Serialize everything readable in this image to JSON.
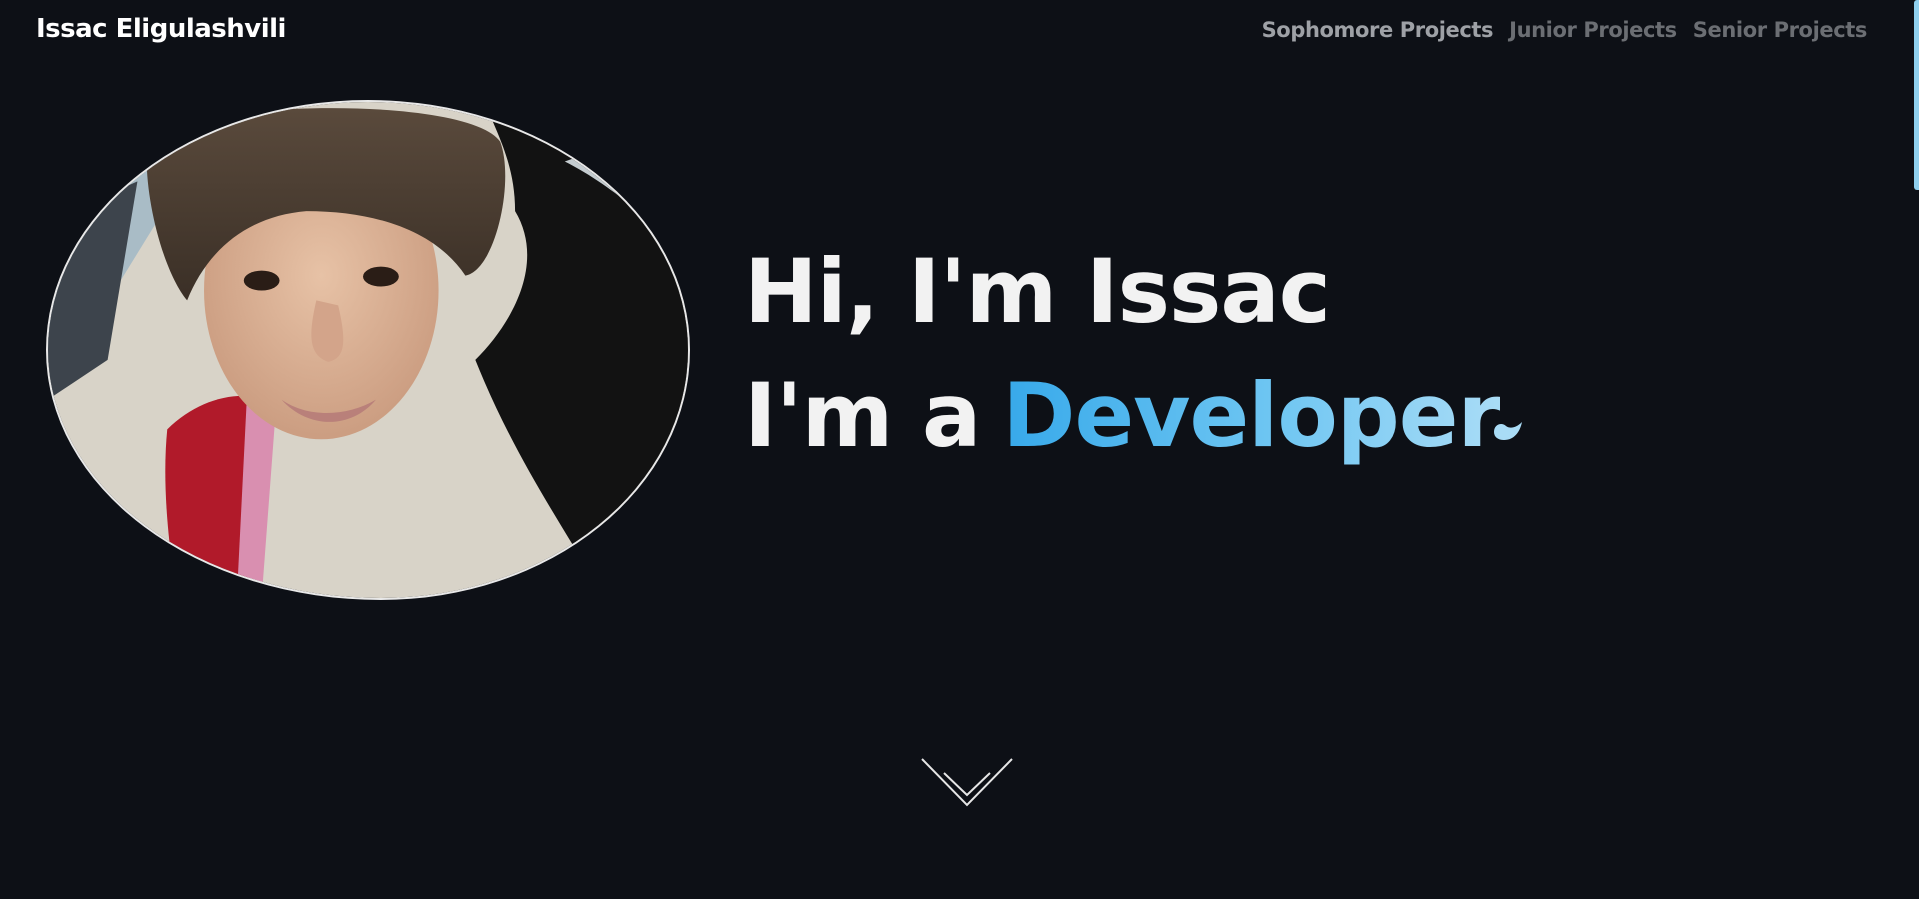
{
  "header": {
    "brand": "Issac Eligulashvili",
    "nav": [
      {
        "label": "Sophomore Projects",
        "active": true
      },
      {
        "label": "Junior Projects",
        "active": false
      },
      {
        "label": "Senior Projects",
        "active": false
      }
    ]
  },
  "hero": {
    "greeting": "Hi, I'm Issac",
    "role_prefix": "I'm a",
    "role": "Developer",
    "portrait_icon": "profile-photo",
    "scroll_icon": "chevron-down-icon"
  },
  "colors": {
    "background": "#0d1016",
    "accent_start": "#37a9ea",
    "accent_end": "#a9dcf6",
    "nav_active": "#9ea1a6",
    "nav_inactive": "#6b6e73"
  }
}
